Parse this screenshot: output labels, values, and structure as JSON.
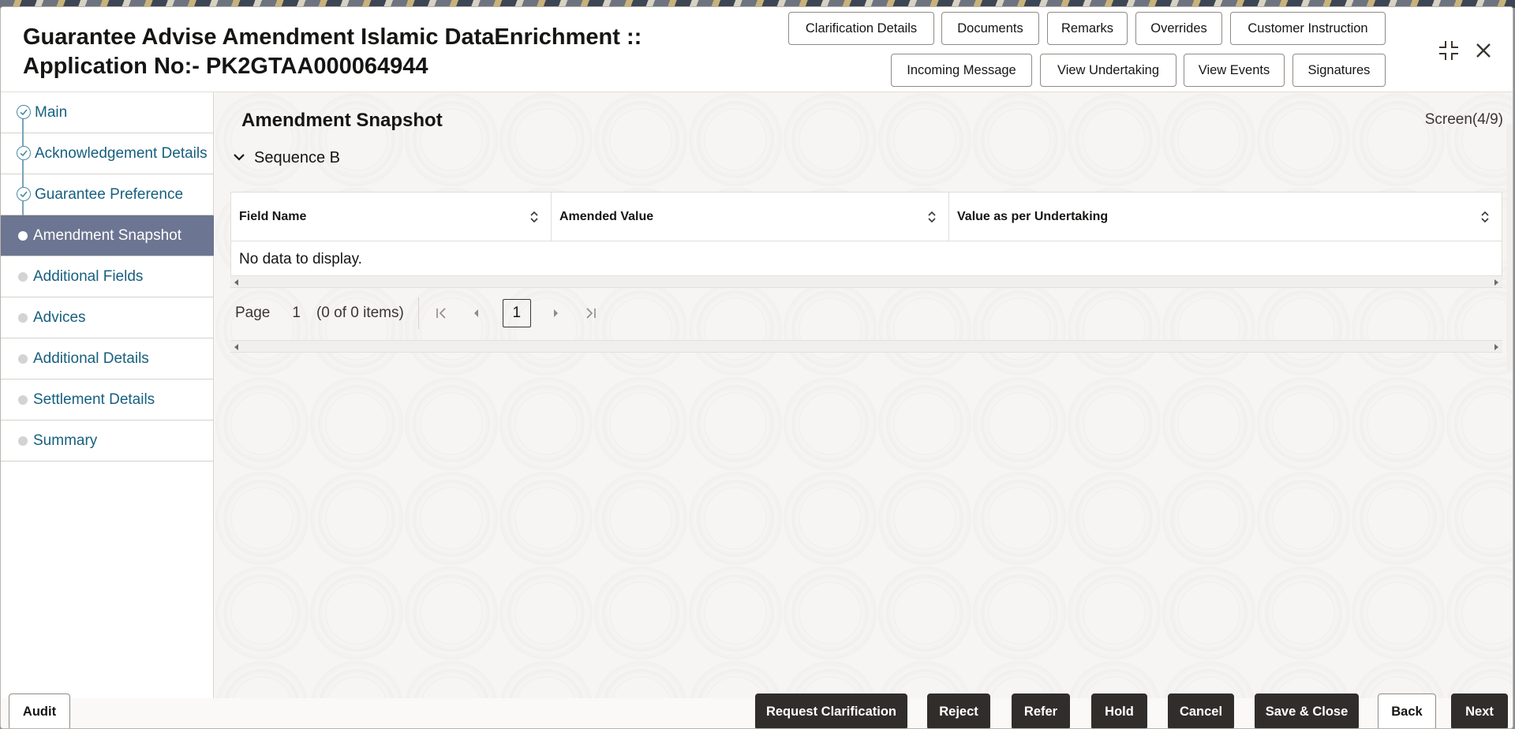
{
  "header": {
    "title_line1": "Guarantee Advise Amendment Islamic DataEnrichment ::",
    "title_line2": "Application No:- PK2GTAA000064944",
    "buttons_row1": [
      "Clarification Details",
      "Documents",
      "Remarks",
      "Overrides",
      "Customer Instruction"
    ],
    "buttons_row2": [
      "Incoming Message",
      "View Undertaking",
      "View Events",
      "Signatures"
    ]
  },
  "sidebar": {
    "items": [
      {
        "label": "Main",
        "state": "done"
      },
      {
        "label": "Acknowledgement Details",
        "state": "done"
      },
      {
        "label": "Guarantee Preference",
        "state": "done"
      },
      {
        "label": "Amendment Snapshot",
        "state": "active"
      },
      {
        "label": "Additional Fields",
        "state": "pending"
      },
      {
        "label": "Advices",
        "state": "pending"
      },
      {
        "label": "Additional Details",
        "state": "pending"
      },
      {
        "label": "Settlement Details",
        "state": "pending"
      },
      {
        "label": "Summary",
        "state": "pending"
      }
    ]
  },
  "main": {
    "title": "Amendment Snapshot",
    "screen_counter": "Screen(4/9)",
    "section": "Sequence B",
    "table": {
      "columns": [
        "Field Name",
        "Amended Value",
        "Value as per Undertaking"
      ],
      "empty_text": "No data to display."
    },
    "pager": {
      "page_label": "Page",
      "page_value": "1",
      "items_text": "(0 of 0 items)",
      "current_page": "1"
    }
  },
  "footer": {
    "audit": "Audit",
    "request_clarification": "Request Clarification",
    "reject": "Reject",
    "refer": "Refer",
    "hold": "Hold",
    "cancel": "Cancel",
    "save_close": "Save & Close",
    "back": "Back",
    "next": "Next"
  },
  "colors": {
    "active_nav": "#6c7591",
    "link": "#17607f",
    "dark_button": "#312d2a"
  }
}
